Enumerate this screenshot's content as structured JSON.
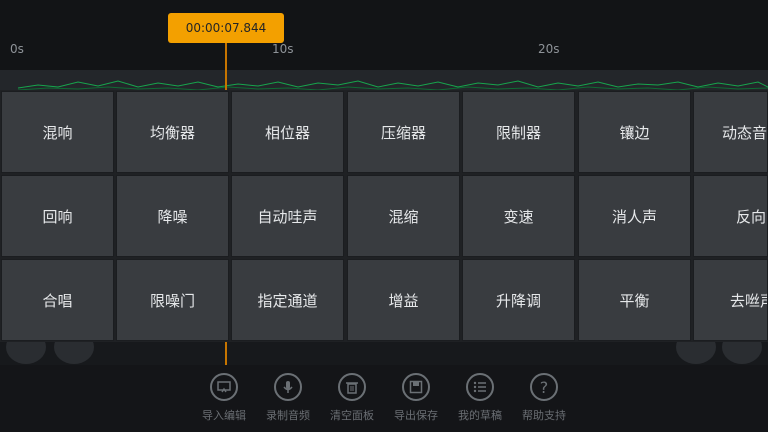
{
  "timeline": {
    "current_time": "00:00:07.844",
    "ticks": [
      "0s",
      "10s",
      "20s"
    ]
  },
  "effects": [
    [
      "混响",
      "均衡器",
      "相位器",
      "压缩器",
      "限制器",
      "镶边",
      "动态音量"
    ],
    [
      "回响",
      "降噪",
      "自动哇声",
      "混缩",
      "变速",
      "消人声",
      "反向"
    ],
    [
      "合唱",
      "限噪门",
      "指定通道",
      "增益",
      "升降调",
      "平衡",
      "去咝声"
    ]
  ],
  "toolbar": [
    {
      "label": "导入编辑",
      "icon": "import-icon"
    },
    {
      "label": "录制音频",
      "icon": "microphone-icon"
    },
    {
      "label": "清空面板",
      "icon": "trash-icon"
    },
    {
      "label": "导出保存",
      "icon": "save-icon"
    },
    {
      "label": "我的草稿",
      "icon": "list-icon"
    },
    {
      "label": "帮助支持",
      "icon": "help-icon"
    }
  ]
}
